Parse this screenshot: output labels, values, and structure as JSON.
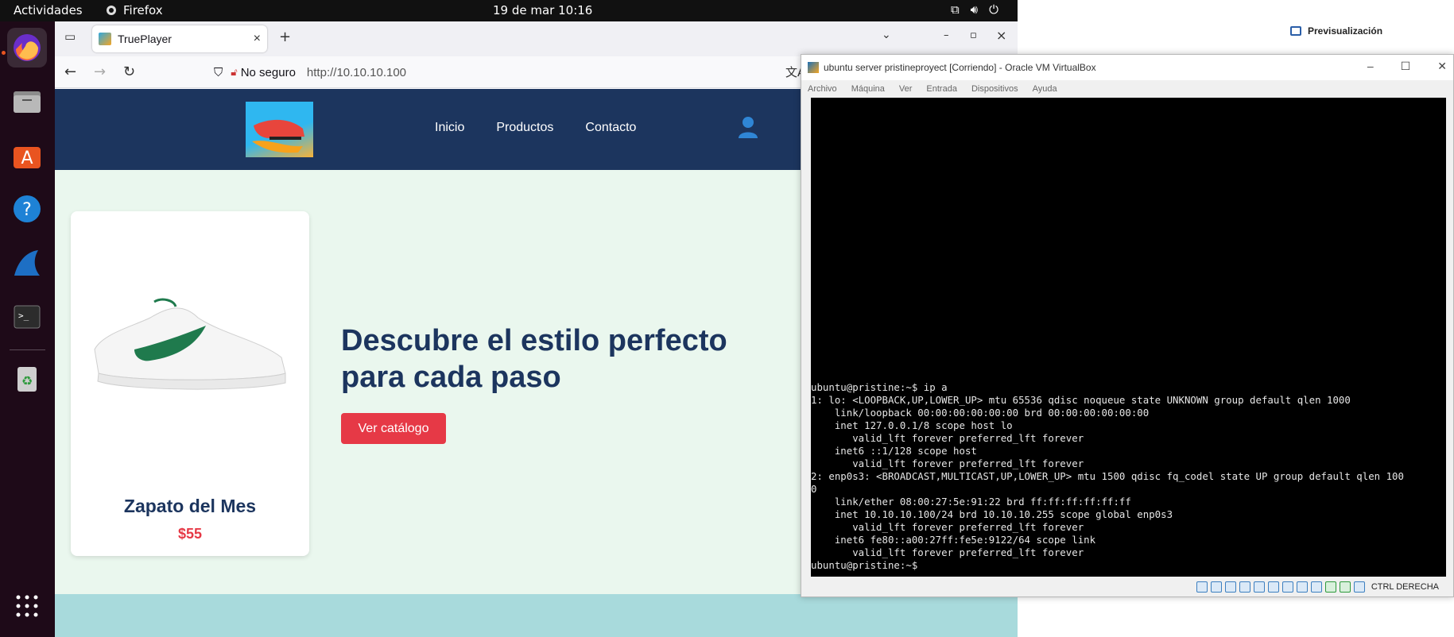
{
  "topbar": {
    "activities": "Actividades",
    "app_name": "Firefox",
    "clock": "19 de mar  10:16",
    "tray_icons": [
      "network-icon",
      "volume-icon",
      "power-icon"
    ]
  },
  "dock": {
    "items": [
      "firefox-icon",
      "files-icon",
      "app-center-icon",
      "help-icon",
      "wireshark-icon",
      "terminal-icon",
      "trash-icon",
      "app-grid-icon"
    ]
  },
  "browser": {
    "tab_title": "TruePlayer",
    "security_label": "No seguro",
    "url": "http://10.10.10.100"
  },
  "site": {
    "nav": [
      "Inicio",
      "Productos",
      "Contacto"
    ],
    "hero_title": "Descubre el estilo perfecto para cada paso",
    "cta": "Ver catálogo",
    "card_title": "Zapato del Mes",
    "card_price": "$55",
    "colors": {
      "header": "#1c355e",
      "accent": "#e63946",
      "hero_bg": "#eaf7ee",
      "footer": "#a8dadc"
    }
  },
  "preview": {
    "title": "Previsualización"
  },
  "vbox": {
    "title": "ubuntu server pristineproyect [Corriendo] - Oracle VM VirtualBox",
    "menu": [
      "Archivo",
      "Máquina",
      "Ver",
      "Entrada",
      "Dispositivos",
      "Ayuda"
    ],
    "host_key": "CTRL DERECHA",
    "terminal": "ubuntu@pristine:~$ ip a\n1: lo: <LOOPBACK,UP,LOWER_UP> mtu 65536 qdisc noqueue state UNKNOWN group default qlen 1000\n    link/loopback 00:00:00:00:00:00 brd 00:00:00:00:00:00\n    inet 127.0.0.1/8 scope host lo\n       valid_lft forever preferred_lft forever\n    inet6 ::1/128 scope host\n       valid_lft forever preferred_lft forever\n2: enp0s3: <BROADCAST,MULTICAST,UP,LOWER_UP> mtu 1500 qdisc fq_codel state UP group default qlen 100\n0\n    link/ether 08:00:27:5e:91:22 brd ff:ff:ff:ff:ff:ff\n    inet 10.10.10.100/24 brd 10.10.10.255 scope global enp0s3\n       valid_lft forever preferred_lft forever\n    inet6 fe80::a00:27ff:fe5e:9122/64 scope link\n       valid_lft forever preferred_lft forever\nubuntu@pristine:~$"
  }
}
